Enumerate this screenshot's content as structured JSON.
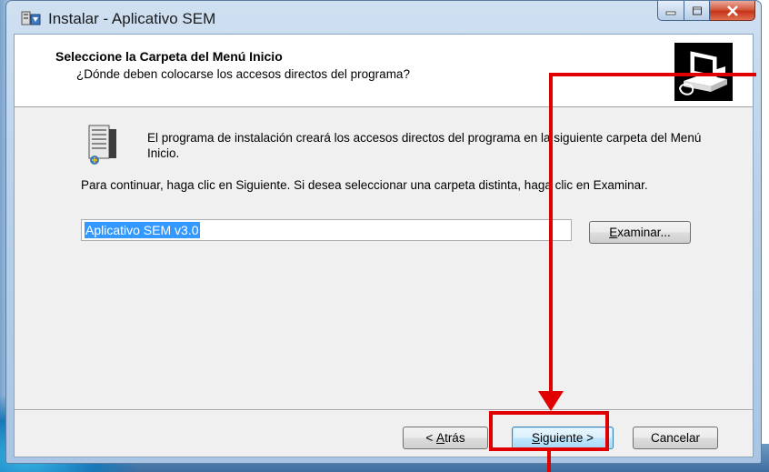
{
  "window": {
    "title": "Instalar - Aplicativo SEM"
  },
  "header": {
    "title": "Seleccione la Carpeta del Menú Inicio",
    "subtitle": "¿Dónde deben colocarse los accesos directos del programa?"
  },
  "content": {
    "info_text": "El programa de instalación creará los accesos directos del programa en la siguiente carpeta del Menú Inicio.",
    "continue_text": "Para continuar, haga clic en Siguiente. Si desea seleccionar una carpeta distinta, haga clic en Examinar.",
    "folder_value": "Aplicativo SEM v3.0",
    "browse_prefix": "",
    "browse_accel": "E",
    "browse_rest": "xaminar..."
  },
  "footer": {
    "back_prefix": "< ",
    "back_accel": "A",
    "back_rest": "trás",
    "next_accel": "S",
    "next_rest": "iguiente >",
    "cancel_label": "Cancelar"
  },
  "icons": {
    "app": "installer-icon",
    "header_image": "computer-setup-image",
    "content": "start-menu-folder-icon"
  },
  "colors": {
    "annotation": "#e00000",
    "selection": "#3399ff",
    "close_button": "#c8331b"
  }
}
